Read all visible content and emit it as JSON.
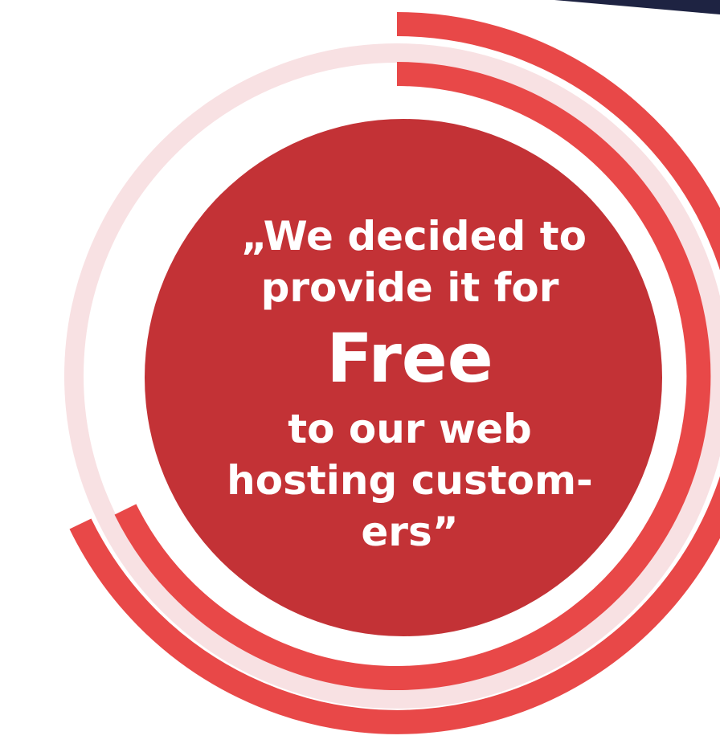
{
  "quote": {
    "line1": "„We decided to",
    "line2": "provide it for",
    "highlight": "Free",
    "line3": "to our web",
    "line4": "hosting custom-",
    "line5": "ers”"
  },
  "colors": {
    "accent_red": "#E84848",
    "circle_red": "#C33236",
    "light_pink": "#F8E1E3",
    "navy": "#1E2342",
    "text": "#FFFFFF"
  }
}
